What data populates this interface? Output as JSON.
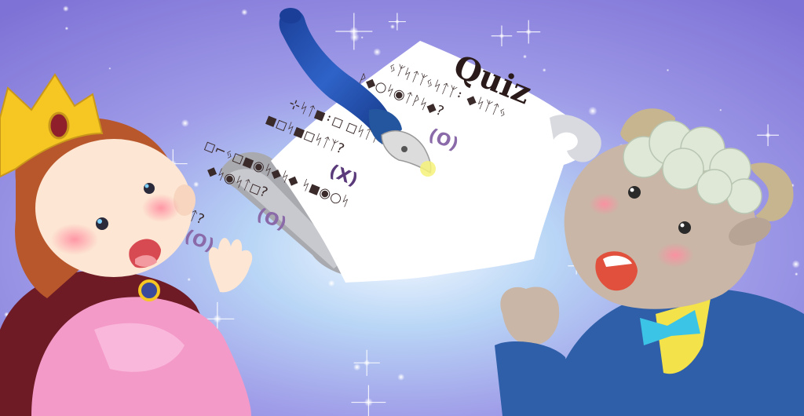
{
  "scroll": {
    "title": "Quiz",
    "questions": [
      {
        "line1": "ᛃᛉᛋᛏᛉᛃᛋᛏᛉ᛬ ◆ᛋᛉᛏᛃ",
        "line2": "ᚹ◆○ᛋ◉ᛏᚹᛋ◆?",
        "answer": "(O)"
      },
      {
        "line1": "⊹ᛋᛏ◼᛬◻ ◻ᛋᛏᛉᛃᛋ",
        "line2": "◼◻ᛋ◼◻ᛋᛏᛉ?",
        "answer": "(X)"
      },
      {
        "line1": "◻⌐ᛃ◻◼◉ᛋ◆ᛋ◆ ᛋ◼◉○ᛋ",
        "line2": "◆ᛋ◉ᛋᛏ◻?",
        "answer": "(O)"
      },
      {
        "line1": "",
        "line2": "ᛃᛋᛏ?",
        "answer": "(O)"
      }
    ]
  },
  "colors": {
    "sky_top": "#8c7fe0",
    "sky_glow": "#eef4ff",
    "mark_o": "#8a6aa8",
    "mark_x": "#5a3a7a",
    "pen_blue": "#1f4fb0",
    "crown": "#f6c623",
    "princess_dress": "#f49ac9",
    "cape": "#7a1f2a",
    "sheep_face": "#c9b6a6",
    "sheep_wool": "#dfe7d6",
    "suit": "#2f5fa8",
    "bowtie": "#3cc4e6",
    "shirt": "#f4e24a"
  },
  "icons": [
    "sparkle-icon",
    "fountain-pen-icon"
  ]
}
